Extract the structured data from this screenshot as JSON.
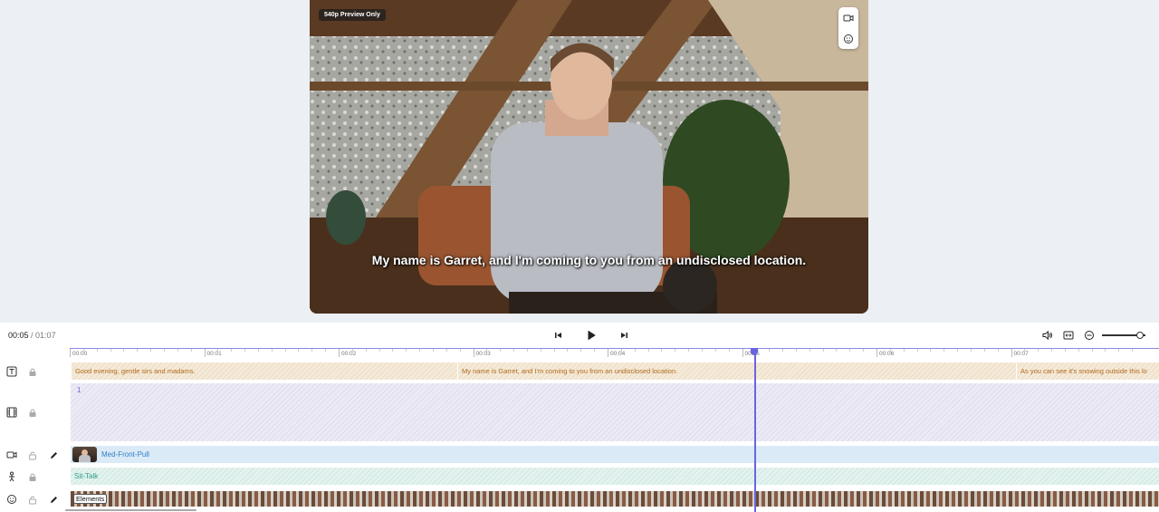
{
  "preview": {
    "badge": "540p Preview Only",
    "subtitle": "My name is Garret, and I'm coming to you from an undisclosed location.",
    "tools": [
      "camera-icon",
      "face-icon"
    ]
  },
  "timeline": {
    "current_time": "00:05",
    "separator": " / ",
    "total_time": "01:07",
    "ruler": [
      "00:00",
      "00:01",
      "00:02",
      "00:03",
      "00:04",
      "00:05",
      "00:06",
      "00:07"
    ],
    "text_clips": [
      "Good evening, gentle sirs and madams.",
      "My name is Garret, and I'm coming to you from an undisclosed location.",
      "As you can see it's snowing outside this lo"
    ],
    "scene_label": "1",
    "camera_clip": "Med-Front-Pull",
    "motion_clip": "Sit-Talk",
    "elements_label": "Elements",
    "zoom_level": 0.8,
    "playhead_time": "00:05"
  },
  "colors": {
    "accent": "#6a64e0",
    "text_clip_text": "#b06a1e",
    "camera_clip_text": "#2f7fc4",
    "motion_clip_text": "#2a9d8a"
  }
}
